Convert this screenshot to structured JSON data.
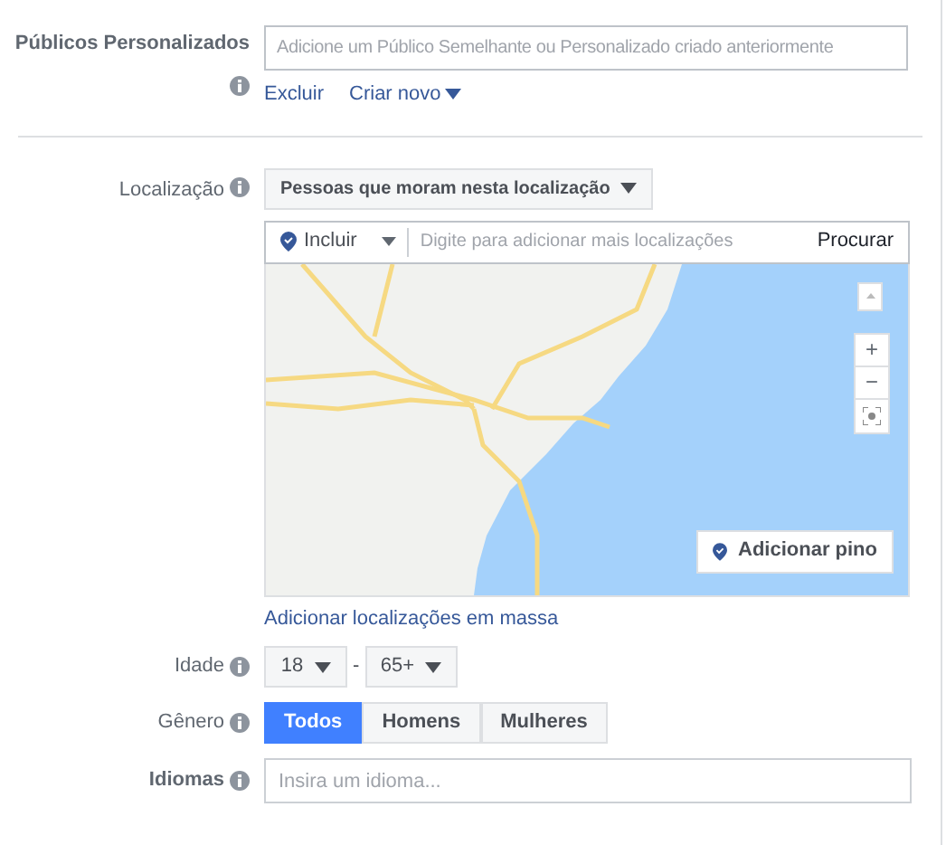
{
  "custom_audiences": {
    "label": "Públicos Personalizados",
    "placeholder": "Adicione um Público Semelhante ou Personalizado criado anteriormente",
    "exclude_link": "Excluir",
    "create_link": "Criar novo"
  },
  "location": {
    "label": "Localização",
    "type_dropdown": "Pessoas que moram nesta localização",
    "include_dropdown": "Incluir",
    "search_placeholder": "Digite para adicionar mais localizações",
    "search_button": "Procurar",
    "map_controls": [
      "+",
      "−"
    ],
    "add_pin_button": "Adicionar pino",
    "bulk_link": "Adicionar localizações em massa"
  },
  "age": {
    "label": "Idade",
    "min": "18",
    "separator": "-",
    "max": "65+"
  },
  "gender": {
    "label": "Gênero",
    "options": [
      {
        "label": "Todos",
        "selected": true
      },
      {
        "label": "Homens",
        "selected": false
      },
      {
        "label": "Mulheres",
        "selected": false
      }
    ]
  },
  "languages": {
    "label": "Idiomas",
    "placeholder": "Insira um idioma..."
  }
}
